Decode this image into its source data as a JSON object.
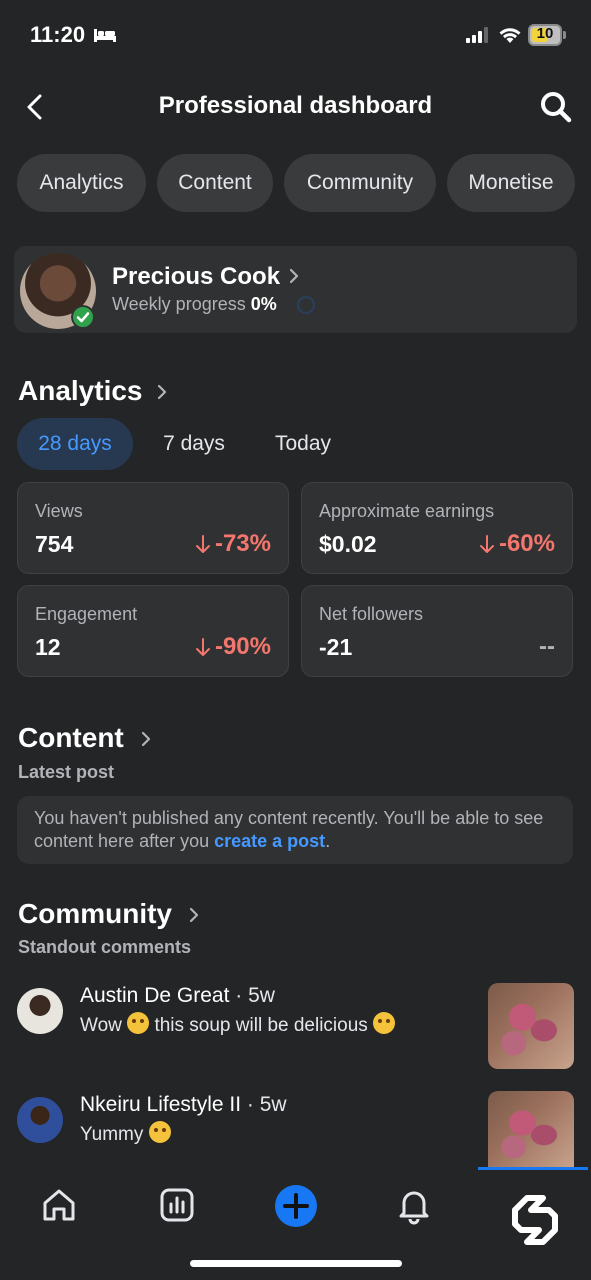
{
  "status_bar": {
    "time": "11:20",
    "battery": "10"
  },
  "header": {
    "title": "Professional dashboard"
  },
  "pills": [
    {
      "label": "Analytics"
    },
    {
      "label": "Content"
    },
    {
      "label": "Community"
    },
    {
      "label": "Monetise"
    }
  ],
  "profile": {
    "name": "Precious Cook",
    "progress_label": "Weekly progress",
    "progress_value": "0%"
  },
  "analytics": {
    "title": "Analytics",
    "tabs": [
      {
        "label": "28 days",
        "active": true
      },
      {
        "label": "7 days",
        "active": false
      },
      {
        "label": "Today",
        "active": false
      }
    ],
    "cards": [
      {
        "label": "Views",
        "value": "754",
        "delta": "-73%"
      },
      {
        "label": "Approximate earnings",
        "value": "$0.02",
        "delta": "-60%"
      },
      {
        "label": "Engagement",
        "value": "12",
        "delta": "-90%"
      },
      {
        "label": "Net followers",
        "value": "-21",
        "delta": "--"
      }
    ]
  },
  "content": {
    "title": "Content",
    "subtitle": "Latest post",
    "notice_text": "You haven't published any content recently. You'll be able to see content here after you ",
    "notice_link": "create a post",
    "notice_end": "."
  },
  "community": {
    "title": "Community",
    "subtitle": "Standout comments",
    "comments": [
      {
        "author": "Austin De Great",
        "time": " · 5w",
        "text_before": "Wow ",
        "text_after": " this soup will be delicious "
      },
      {
        "author": "Nkeiru Lifestyle II",
        "time": " · 5w",
        "text_before": "Yummy ",
        "text_after": ""
      }
    ]
  },
  "colors": {
    "background": "#242526",
    "card": "#303132",
    "accent": "#4599ff",
    "negative": "#f3776e",
    "create_button": "#1877f2"
  }
}
